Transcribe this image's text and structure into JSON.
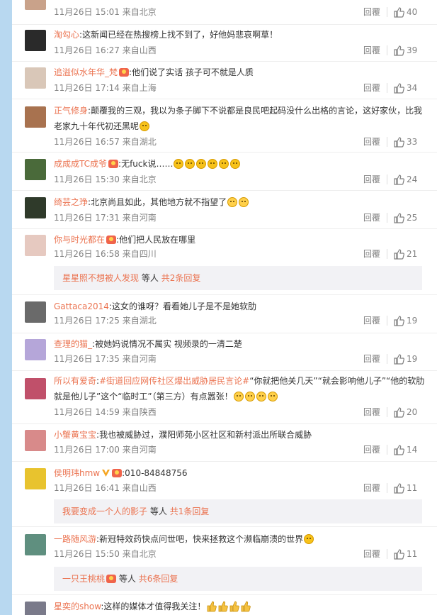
{
  "comments": [
    {
      "user": "",
      "sep": ":",
      "text": "",
      "date": "11月26日 15:01",
      "location": "来自北京",
      "reply": "回覆",
      "likes": "40",
      "avatar_color": "#c9a28a"
    },
    {
      "user": "淘勾心",
      "sep": ":",
      "text": "这新闻已经在热搜榜上找不到了，好他妈悲哀啊草！",
      "date": "11月26日 16:27",
      "location": "来自山西",
      "reply": "回覆",
      "likes": "39",
      "avatar_color": "#2a2a2a"
    },
    {
      "user": "追溢似水年华_梵",
      "sep": ":",
      "text": "他们说了实话 孩子可不就是人质",
      "date": "11月26日 17:14",
      "location": "来自上海",
      "reply": "回覆",
      "likes": "34",
      "avatar_color": "#d9c7b8"
    },
    {
      "user": "正气修身",
      "sep": ":",
      "text": "颠覆我的三观，我以为条子脚下不说都是良民吧起码没什么出格的言论，这好家伙，比我老家九十年代初还黑呢",
      "date": "11月26日 16:57",
      "location": "来自湖北",
      "reply": "回覆",
      "likes": "33",
      "avatar_color": "#a8724f"
    },
    {
      "user": "成成成TC成爷",
      "sep": ":",
      "text": "无fuck说……",
      "date": "11月26日 15:30",
      "location": "来自北京",
      "reply": "回覆",
      "likes": "24",
      "avatar_color": "#4a6a3a"
    },
    {
      "user": "绮芸之琤",
      "sep": ":",
      "text": "北京尚且如此，其他地方就不指望了",
      "date": "11月26日 17:31",
      "location": "来自河南",
      "reply": "回覆",
      "likes": "25",
      "avatar_color": "#2f3a2a"
    },
    {
      "user": "你与时光都在",
      "sep": ":",
      "text": "他们把人民放在哪里",
      "date": "11月26日 16:58",
      "location": "来自四川",
      "reply": "回覆",
      "likes": "21",
      "avatar_color": "#e6c9c0"
    },
    {
      "user": "Gattaca2014",
      "sep": ":",
      "text": "这女的谁呀？看看她儿子是不是她软肋",
      "date": "11月26日 17:25",
      "location": "来自湖北",
      "reply": "回覆",
      "likes": "19",
      "avatar_color": "#6a6a6a"
    },
    {
      "user": "查理的猫_",
      "sep": ":",
      "text": "被她妈说情况不属实 视频录的一清二楚",
      "date": "11月26日 17:35",
      "location": "来自河南",
      "reply": "回覆",
      "likes": "19",
      "avatar_color": "#b5a6d9"
    },
    {
      "user": "所以有爱奇",
      "sep": ":",
      "text": "",
      "hashtag": "#街道回应网传社区爆出威胁居民言论#",
      "text2": "“你就把他关几天”“就会影响他儿子”“他的软肋就是他儿子”这个“临时工”（第三方）有点嚣张！",
      "date": "11月26日 14:59",
      "location": "来自陕西",
      "reply": "回覆",
      "likes": "20",
      "avatar_color": "#c0506a"
    },
    {
      "user": "小蟹黄宝宝",
      "sep": ":",
      "text": "我也被威胁过，濮阳师苑小区社区和新村派出所联合威胁",
      "date": "11月26日 17:00",
      "location": "来自河南",
      "reply": "回覆",
      "likes": "14",
      "avatar_color": "#d88a8a"
    },
    {
      "user": "侯明玮hmw",
      "sep": ":",
      "text": "010-84848756",
      "date": "11月26日 16:41",
      "location": "来自山西",
      "reply": "回覆",
      "likes": "11",
      "avatar_color": "#e8c32e"
    },
    {
      "user": "一路随风游",
      "sep": ":",
      "text": "新冠特效药快点问世吧，快来拯救这个濒临崩溃的世界",
      "date": "11月26日 15:50",
      "location": "来自北京",
      "reply": "回覆",
      "likes": "11",
      "avatar_color": "#5f8f7f"
    },
    {
      "user": "星奕的show",
      "sep": ":",
      "text": "这样的媒体才值得我关注！",
      "date": "",
      "location": "",
      "reply": "",
      "likes": "",
      "avatar_color": "#7a7a8a"
    }
  ],
  "subreplies": [
    {
      "name": "星星照不想被人发现",
      "middle": "等人",
      "more": "共2条回复"
    },
    {
      "name": "我要变成一个人的影子",
      "middle": "等人",
      "more": "共1条回复"
    },
    {
      "name": "一只王桃桃",
      "middle": "等人",
      "more": "共6条回复"
    }
  ]
}
